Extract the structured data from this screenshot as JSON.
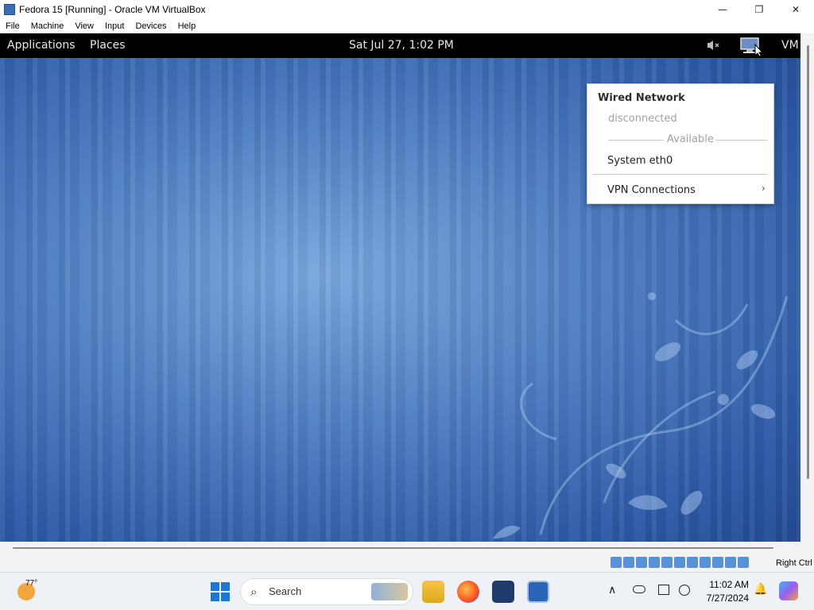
{
  "window": {
    "title": "Fedora 15 [Running] - Oracle VM VirtualBox",
    "controls": {
      "minimize": "—",
      "restore": "❐",
      "close": "✕"
    }
  },
  "menubar": {
    "items": [
      {
        "label": "File"
      },
      {
        "label": "Machine"
      },
      {
        "label": "View"
      },
      {
        "label": "Input"
      },
      {
        "label": "Devices"
      },
      {
        "label": "Help"
      }
    ]
  },
  "guest_panel": {
    "applications": "Applications",
    "places": "Places",
    "clock": "Sat Jul 27,  1:02 PM",
    "user": "VM"
  },
  "network_menu": {
    "heading": "Wired Network",
    "status": "disconnected",
    "section": "Available",
    "connection": "System eth0",
    "vpn": "VPN Connections",
    "vpn_arrow": "›"
  },
  "statusbar": {
    "host_key": "Right Ctrl"
  },
  "taskbar": {
    "weather_temp": "77°",
    "search_placeholder": "Search",
    "time": "11:02 AM",
    "date": "7/27/2024",
    "tray_icons": {
      "chevron": "∧",
      "bell": "🔔"
    }
  },
  "colors": {
    "desktop_blue": "#4f7fc3",
    "panel_black": "#000000",
    "accent": "#1a78d4"
  }
}
